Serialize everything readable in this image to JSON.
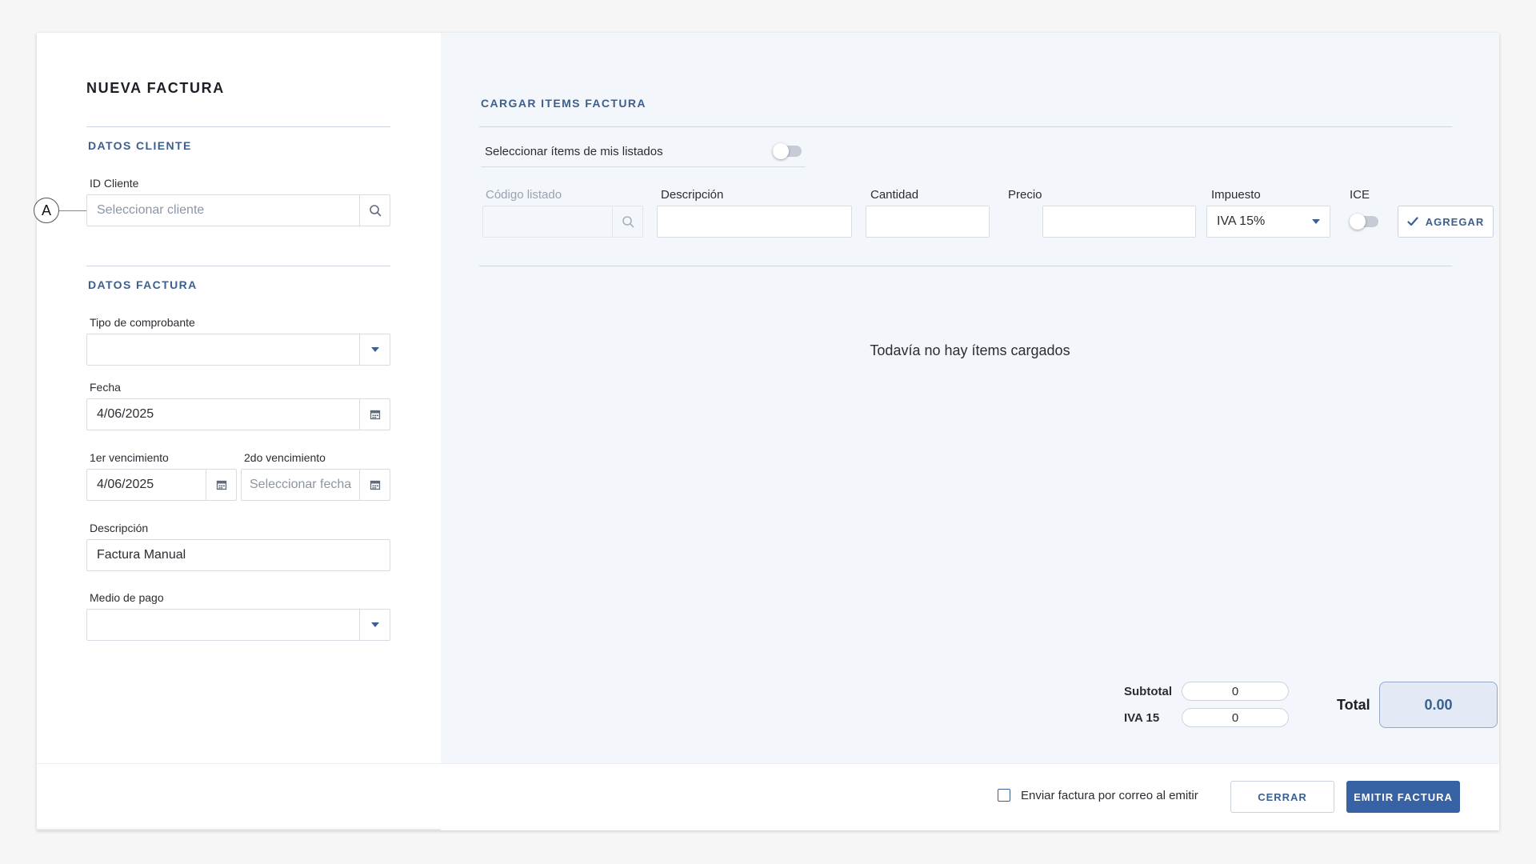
{
  "page": {
    "title": "NUEVA FACTURA"
  },
  "client_section": {
    "title": "DATOS CLIENTE",
    "id_label": "ID Cliente",
    "id_placeholder": "Seleccionar cliente",
    "marker": "A"
  },
  "invoice_section": {
    "title": "DATOS FACTURA",
    "voucher_type_label": "Tipo de comprobante",
    "voucher_type_value": "",
    "date_label": "Fecha",
    "date_value": "4/06/2025",
    "due1_label": "1er vencimiento",
    "due1_value": "4/06/2025",
    "due2_label": "2do vencimiento",
    "due2_placeholder": "Seleccionar fecha",
    "description_label": "Descripción",
    "description_value": "Factura Manual",
    "payment_label": "Medio de pago",
    "payment_value": ""
  },
  "items_section": {
    "title": "CARGAR ITEMS FACTURA",
    "toggle_label": "Seleccionar ítems de mis listados",
    "code_label": "Código listado",
    "description_label": "Descripción",
    "quantity_label": "Cantidad",
    "price_label": "Precio",
    "tax_label": "Impuesto",
    "tax_value": "IVA 15%",
    "ice_label": "ICE",
    "add_button": "AGREGAR",
    "empty_message": "Todavía no hay ítems cargados"
  },
  "totals": {
    "subtotal_label": "Subtotal",
    "subtotal_value": "0",
    "iva_label": "IVA 15",
    "iva_value": "0",
    "total_label": "Total",
    "total_value": "0.00"
  },
  "footer": {
    "email_checkbox_label": "Enviar factura por correo al emitir",
    "close_button": "CERRAR",
    "emit_button": "EMITIR FACTURA"
  },
  "icons": {
    "search": "search-icon",
    "calendar": "calendar-icon",
    "dropdown": "caret-down-icon",
    "check": "check-icon"
  },
  "colors": {
    "accent": "#3b5f8f",
    "primary_button": "#3762a4",
    "right_panel_bg": "#f3f6fb"
  }
}
